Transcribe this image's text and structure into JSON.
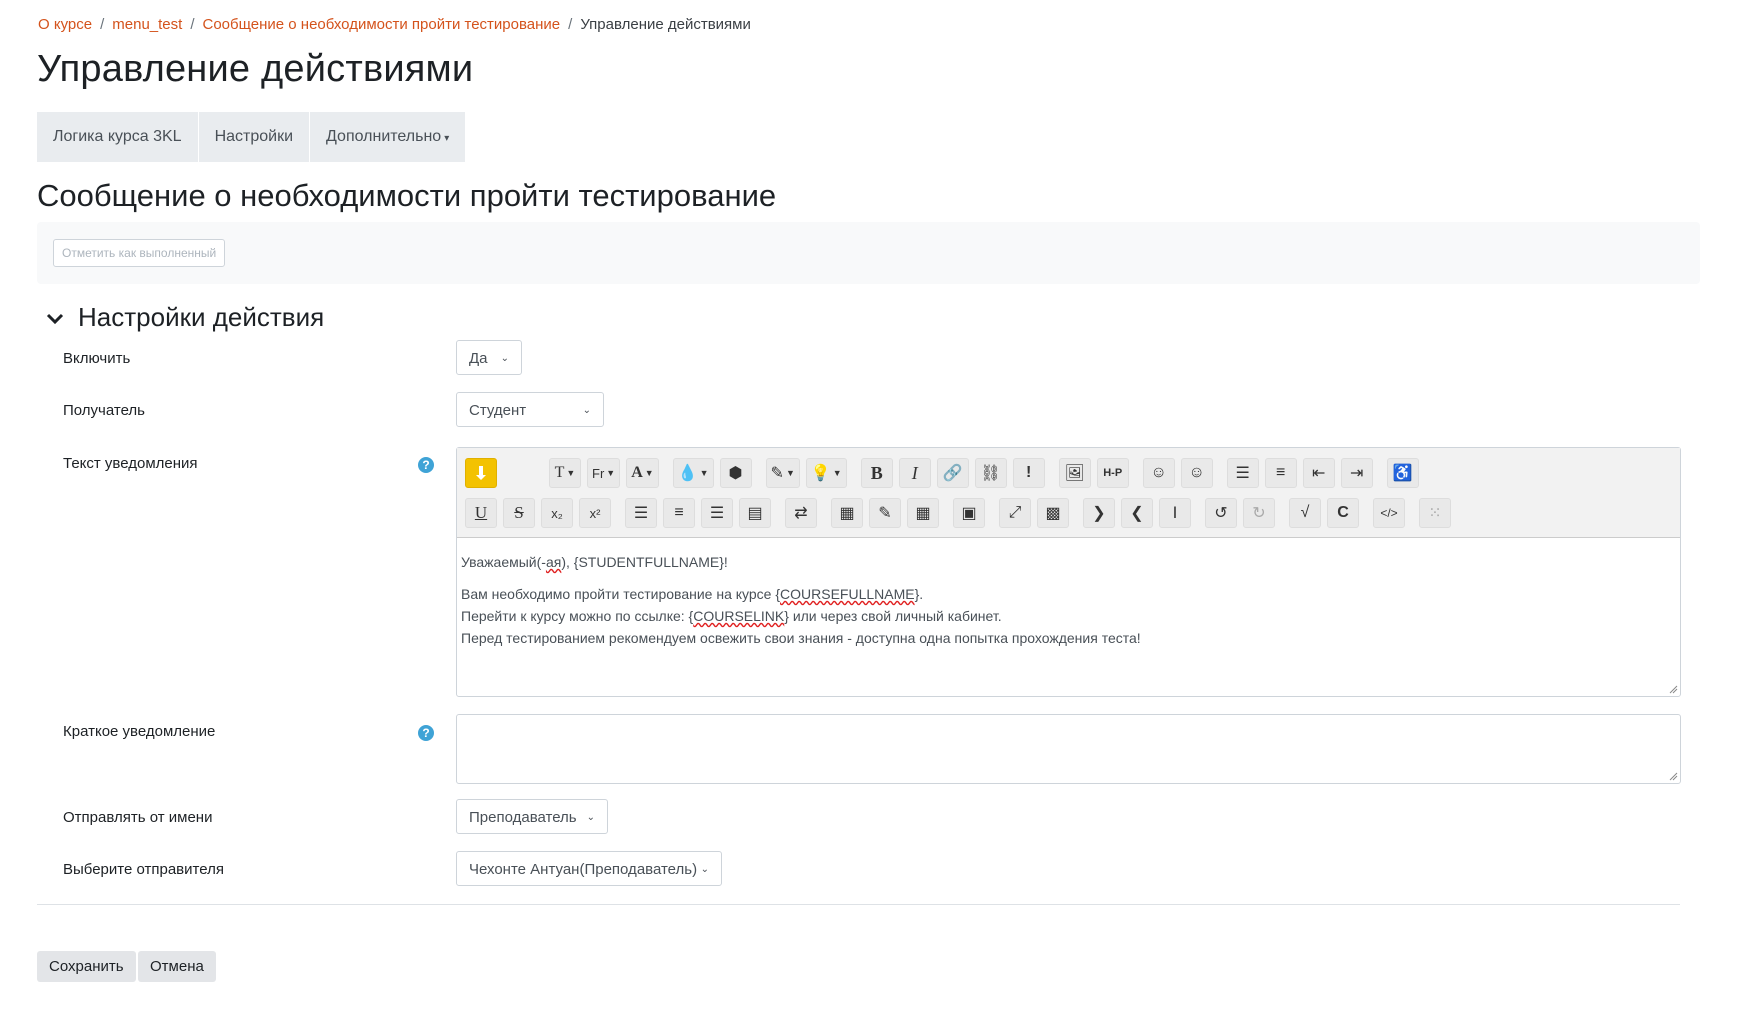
{
  "breadcrumb": [
    {
      "label": "О курсе"
    },
    {
      "label": "menu_test"
    },
    {
      "label": "Сообщение о необходимости пройти тестирование"
    },
    {
      "label": "Управление действиями"
    }
  ],
  "page_title": "Управление действиями",
  "tabs": [
    {
      "label": "Логика курса 3KL"
    },
    {
      "label": "Настройки"
    },
    {
      "label": "Дополнительно"
    }
  ],
  "subtitle": "Сообщение о необходимости пройти тестирование",
  "mark_complete_label": "Отметить как выполненный",
  "section": {
    "title": "Настройки действия"
  },
  "form": {
    "enable": {
      "label": "Включить",
      "value": "Да"
    },
    "recipient": {
      "label": "Получатель",
      "value": "Студент"
    },
    "notification_text": {
      "label": "Текст уведомления",
      "lines": {
        "l1_a": "Уважаемый(-",
        "l1_b": "ая",
        "l1_c": "), {STUDENTFULLNAME}!",
        "l2_a": "Вам необходимо пройти тестирование на курсе {",
        "l2_b": "COURSEFULLNAME",
        "l2_c": "}.",
        "l3_a": "Перейти к курсу можно по ссылке: {",
        "l3_b": "COURSELINK",
        "l3_c": "} или через свой личный кабинет.",
        "l4": "Перед тестированием рекомендуем освежить свои знания - доступна одна попытка прохождения теста!"
      }
    },
    "short_notification": {
      "label": "Краткое уведомление",
      "value": ""
    },
    "send_as": {
      "label": "Отправлять от имени",
      "value": "Преподаватель"
    },
    "sender": {
      "label": "Выберите отправителя",
      "value": "Чехонте Антуан(Преподаватель)"
    }
  },
  "toolbar": {
    "font_size_glyph": "T",
    "font_family_glyph": "Fr",
    "font_color_glyph": "A",
    "bold_glyph": "B",
    "italic_glyph": "I",
    "h5p_glyph": "H-P",
    "underline_glyph": "U",
    "strike_glyph": "S",
    "sub_glyph": "x₂",
    "sup_glyph": "x²"
  },
  "buttons": {
    "save": "Сохранить",
    "cancel": "Отмена"
  },
  "colors": {
    "link": "#d4531c",
    "highlight": "#f3c201",
    "help": "#3fa3d6"
  }
}
